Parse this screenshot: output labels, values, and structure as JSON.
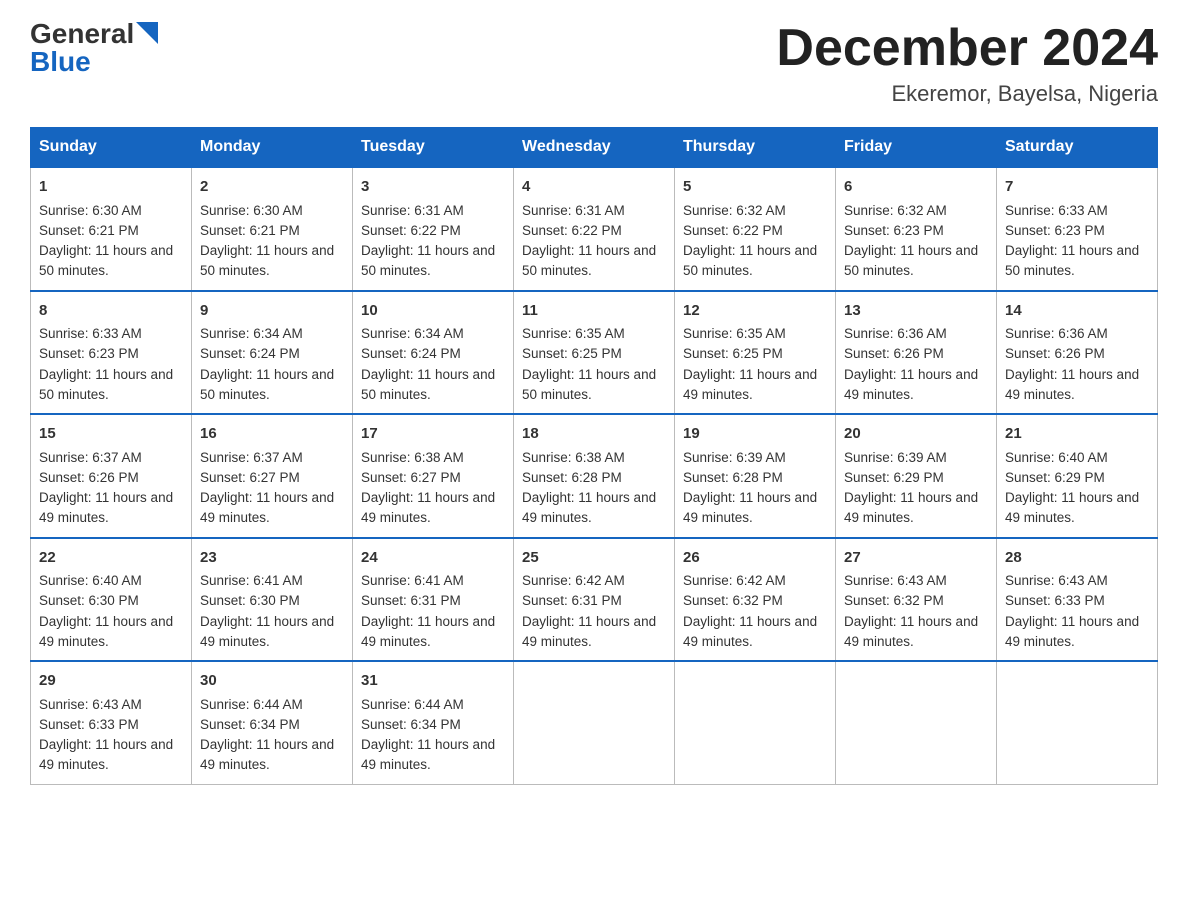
{
  "logo": {
    "general": "General",
    "blue": "Blue"
  },
  "title": "December 2024",
  "location": "Ekeremor, Bayelsa, Nigeria",
  "weekdays": [
    "Sunday",
    "Monday",
    "Tuesday",
    "Wednesday",
    "Thursday",
    "Friday",
    "Saturday"
  ],
  "weeks": [
    [
      {
        "day": "1",
        "sunrise": "6:30 AM",
        "sunset": "6:21 PM",
        "daylight": "11 hours and 50 minutes."
      },
      {
        "day": "2",
        "sunrise": "6:30 AM",
        "sunset": "6:21 PM",
        "daylight": "11 hours and 50 minutes."
      },
      {
        "day": "3",
        "sunrise": "6:31 AM",
        "sunset": "6:22 PM",
        "daylight": "11 hours and 50 minutes."
      },
      {
        "day": "4",
        "sunrise": "6:31 AM",
        "sunset": "6:22 PM",
        "daylight": "11 hours and 50 minutes."
      },
      {
        "day": "5",
        "sunrise": "6:32 AM",
        "sunset": "6:22 PM",
        "daylight": "11 hours and 50 minutes."
      },
      {
        "day": "6",
        "sunrise": "6:32 AM",
        "sunset": "6:23 PM",
        "daylight": "11 hours and 50 minutes."
      },
      {
        "day": "7",
        "sunrise": "6:33 AM",
        "sunset": "6:23 PM",
        "daylight": "11 hours and 50 minutes."
      }
    ],
    [
      {
        "day": "8",
        "sunrise": "6:33 AM",
        "sunset": "6:23 PM",
        "daylight": "11 hours and 50 minutes."
      },
      {
        "day": "9",
        "sunrise": "6:34 AM",
        "sunset": "6:24 PM",
        "daylight": "11 hours and 50 minutes."
      },
      {
        "day": "10",
        "sunrise": "6:34 AM",
        "sunset": "6:24 PM",
        "daylight": "11 hours and 50 minutes."
      },
      {
        "day": "11",
        "sunrise": "6:35 AM",
        "sunset": "6:25 PM",
        "daylight": "11 hours and 50 minutes."
      },
      {
        "day": "12",
        "sunrise": "6:35 AM",
        "sunset": "6:25 PM",
        "daylight": "11 hours and 49 minutes."
      },
      {
        "day": "13",
        "sunrise": "6:36 AM",
        "sunset": "6:26 PM",
        "daylight": "11 hours and 49 minutes."
      },
      {
        "day": "14",
        "sunrise": "6:36 AM",
        "sunset": "6:26 PM",
        "daylight": "11 hours and 49 minutes."
      }
    ],
    [
      {
        "day": "15",
        "sunrise": "6:37 AM",
        "sunset": "6:26 PM",
        "daylight": "11 hours and 49 minutes."
      },
      {
        "day": "16",
        "sunrise": "6:37 AM",
        "sunset": "6:27 PM",
        "daylight": "11 hours and 49 minutes."
      },
      {
        "day": "17",
        "sunrise": "6:38 AM",
        "sunset": "6:27 PM",
        "daylight": "11 hours and 49 minutes."
      },
      {
        "day": "18",
        "sunrise": "6:38 AM",
        "sunset": "6:28 PM",
        "daylight": "11 hours and 49 minutes."
      },
      {
        "day": "19",
        "sunrise": "6:39 AM",
        "sunset": "6:28 PM",
        "daylight": "11 hours and 49 minutes."
      },
      {
        "day": "20",
        "sunrise": "6:39 AM",
        "sunset": "6:29 PM",
        "daylight": "11 hours and 49 minutes."
      },
      {
        "day": "21",
        "sunrise": "6:40 AM",
        "sunset": "6:29 PM",
        "daylight": "11 hours and 49 minutes."
      }
    ],
    [
      {
        "day": "22",
        "sunrise": "6:40 AM",
        "sunset": "6:30 PM",
        "daylight": "11 hours and 49 minutes."
      },
      {
        "day": "23",
        "sunrise": "6:41 AM",
        "sunset": "6:30 PM",
        "daylight": "11 hours and 49 minutes."
      },
      {
        "day": "24",
        "sunrise": "6:41 AM",
        "sunset": "6:31 PM",
        "daylight": "11 hours and 49 minutes."
      },
      {
        "day": "25",
        "sunrise": "6:42 AM",
        "sunset": "6:31 PM",
        "daylight": "11 hours and 49 minutes."
      },
      {
        "day": "26",
        "sunrise": "6:42 AM",
        "sunset": "6:32 PM",
        "daylight": "11 hours and 49 minutes."
      },
      {
        "day": "27",
        "sunrise": "6:43 AM",
        "sunset": "6:32 PM",
        "daylight": "11 hours and 49 minutes."
      },
      {
        "day": "28",
        "sunrise": "6:43 AM",
        "sunset": "6:33 PM",
        "daylight": "11 hours and 49 minutes."
      }
    ],
    [
      {
        "day": "29",
        "sunrise": "6:43 AM",
        "sunset": "6:33 PM",
        "daylight": "11 hours and 49 minutes."
      },
      {
        "day": "30",
        "sunrise": "6:44 AM",
        "sunset": "6:34 PM",
        "daylight": "11 hours and 49 minutes."
      },
      {
        "day": "31",
        "sunrise": "6:44 AM",
        "sunset": "6:34 PM",
        "daylight": "11 hours and 49 minutes."
      },
      null,
      null,
      null,
      null
    ]
  ]
}
